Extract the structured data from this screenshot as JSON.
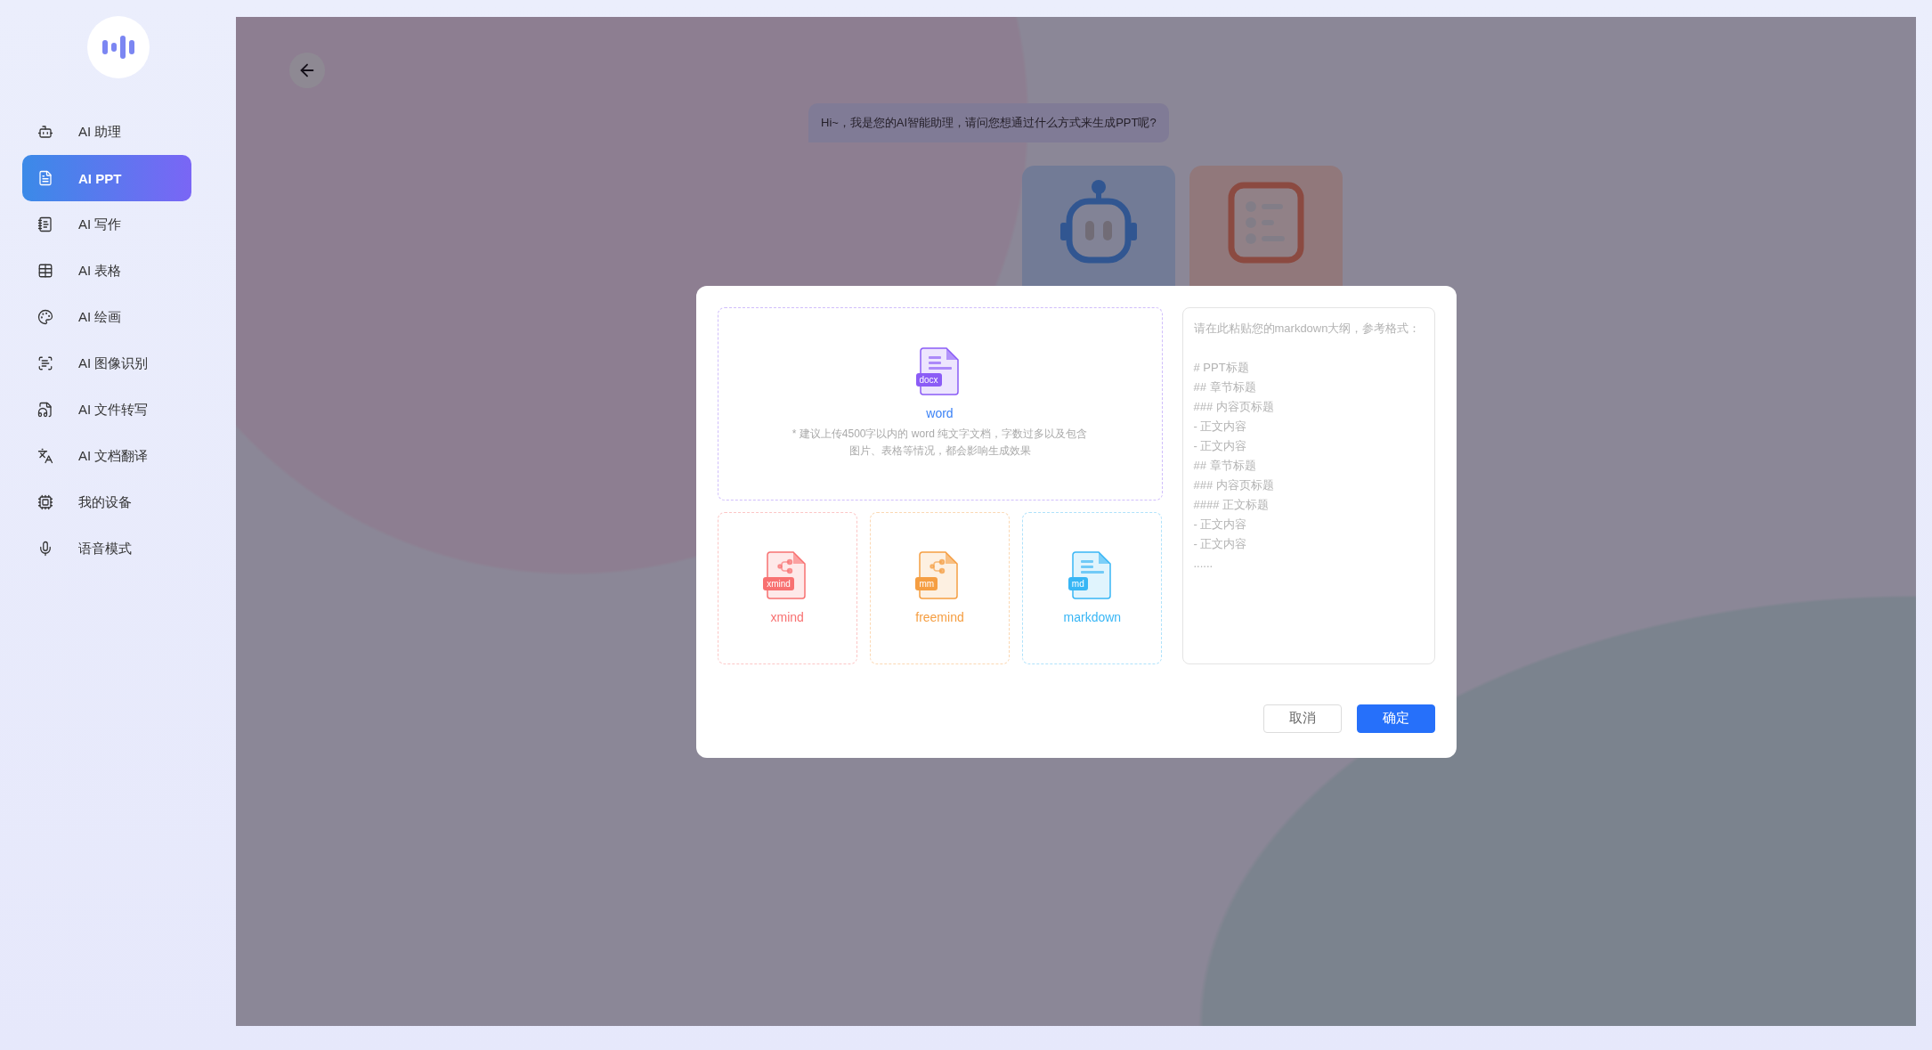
{
  "sidebar": {
    "items": [
      {
        "kind": "robot",
        "label": "AI 助理",
        "selected": false
      },
      {
        "kind": "ppt",
        "label": "AI PPT",
        "selected": true
      },
      {
        "kind": "writing",
        "label": "AI 写作",
        "selected": false
      },
      {
        "kind": "table",
        "label": "AI 表格",
        "selected": false
      },
      {
        "kind": "palette",
        "label": "AI 绘画",
        "selected": false
      },
      {
        "kind": "ocr",
        "label": "AI 图像识别",
        "selected": false
      },
      {
        "kind": "transcribe",
        "label": "AI 文件转写",
        "selected": false
      },
      {
        "kind": "translate",
        "label": "AI 文档翻译",
        "selected": false
      },
      {
        "kind": "device",
        "label": "我的设备",
        "selected": false
      },
      {
        "kind": "mic",
        "label": "语音模式",
        "selected": false
      }
    ]
  },
  "chat": {
    "greeting": "Hi~，我是您的AI智能助理，请问您想通过什么方式来生成PPT呢?"
  },
  "dialog": {
    "main_option": {
      "kind": "word",
      "label": "word",
      "badge": "docx",
      "color": "#8b5cf6",
      "note": "* 建议上传4500字以内的 word 纯文字文档，字数过多以及包含图片、表格等情况，都会影响生成效果"
    },
    "options": [
      {
        "kind": "mindmap",
        "label": "xmind",
        "badge": "xmind",
        "color": "#f87171"
      },
      {
        "kind": "mindmap",
        "label": "freemind",
        "badge": "mm",
        "color": "#f59e42"
      },
      {
        "kind": "lines",
        "label": "markdown",
        "badge": "md",
        "color": "#38b6f5"
      }
    ],
    "outline": {
      "placeholder": "请在此粘贴您的markdown大纲，参考格式：\n\n# PPT标题\n## 章节标题\n### 内容页标题\n- 正文内容\n- 正文内容\n## 章节标题\n### 内容页标题\n#### 正文标题\n- 正文内容\n- 正文内容\n......"
    },
    "buttons": [
      {
        "kind": "cancel",
        "label": "取消"
      },
      {
        "kind": "primary",
        "label": "确定"
      }
    ]
  }
}
